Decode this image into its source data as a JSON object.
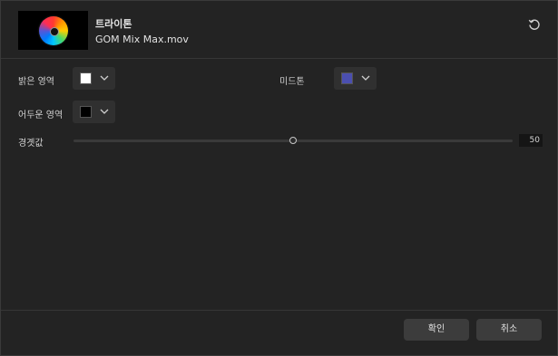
{
  "header": {
    "title": "트라이톤",
    "filename": "GOM Mix Max.mov"
  },
  "controls": {
    "highlight": {
      "label": "밝은 영역",
      "color": "#ffffff"
    },
    "midtone": {
      "label": "미드톤",
      "color": "#4b4fb0"
    },
    "shadow": {
      "label": "어두운 영역",
      "color": "#000000"
    },
    "threshold": {
      "label": "경곗값",
      "value": "50",
      "fraction": 0.5
    }
  },
  "footer": {
    "ok_label": "확인",
    "cancel_label": "취소"
  },
  "icons": {
    "reset": "reset-icon",
    "dropdown": "chevron-down-icon"
  }
}
